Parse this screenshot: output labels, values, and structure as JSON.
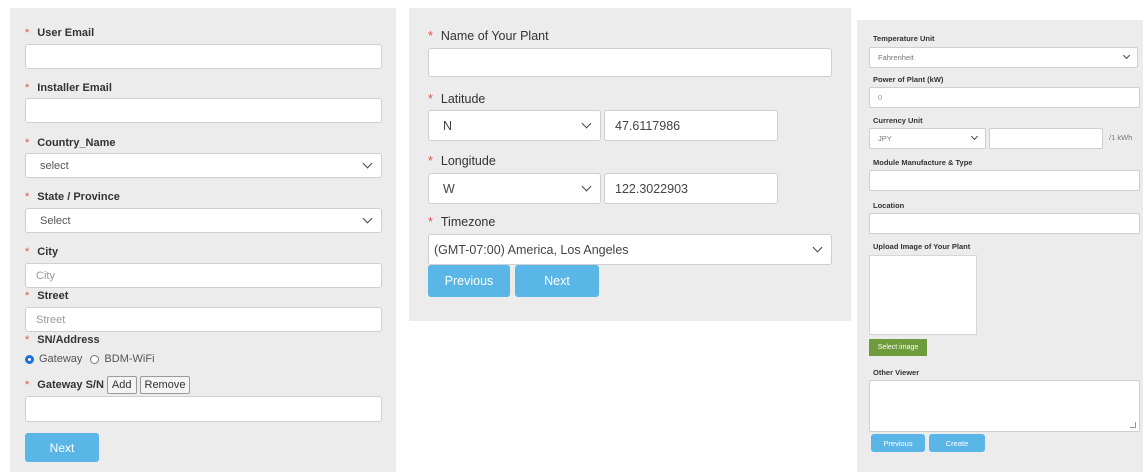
{
  "form1": {
    "user_email_label": "User Email",
    "installer_email_label": "Installer Email",
    "country_label": "Country_Name",
    "country_value": "select",
    "state_label": "State / Province",
    "state_value": "Select",
    "city_label": "City",
    "city_placeholder": "City",
    "street_label": "Street",
    "street_placeholder": "Street",
    "sn_label": "SN/Address",
    "radio_gateway": "Gateway",
    "radio_wifi": "BDM-WiFi",
    "gateway_sn_label": "Gateway S/N",
    "add_label": "Add",
    "remove_label": "Remove",
    "next_label": "Next"
  },
  "form2": {
    "plant_name_label": "Name of Your Plant",
    "latitude_label": "Latitude",
    "lat_dir": "N",
    "lat_value": "47.6117986",
    "longitude_label": "Longitude",
    "lon_dir": "W",
    "lon_value": "122.3022903",
    "timezone_label": "Timezone",
    "timezone_value": "(GMT-07:00) America, Los Angeles",
    "previous_label": "Previous",
    "next_label": "Next"
  },
  "form3": {
    "temp_unit_label": "Temperature Unit",
    "temp_unit_value": "Fahrenheit",
    "power_label": "Power of Plant (kW)",
    "power_value": "0",
    "currency_label": "Currency Unit",
    "currency_value": "JPY",
    "per_kwh": "/1 kWh",
    "module_label": "Module Manufacture & Type",
    "location_label": "Location",
    "upload_label": "Upload Image of Your Plant",
    "select_image_label": "Select image",
    "other_viewer_label": "Other Viewer",
    "previous_label": "Previous",
    "create_label": "Create"
  },
  "colors": {
    "accent": "#5bb6e8",
    "required": "#e0524f",
    "green": "#6e9b3c",
    "panel": "#ececec"
  },
  "star": "*"
}
